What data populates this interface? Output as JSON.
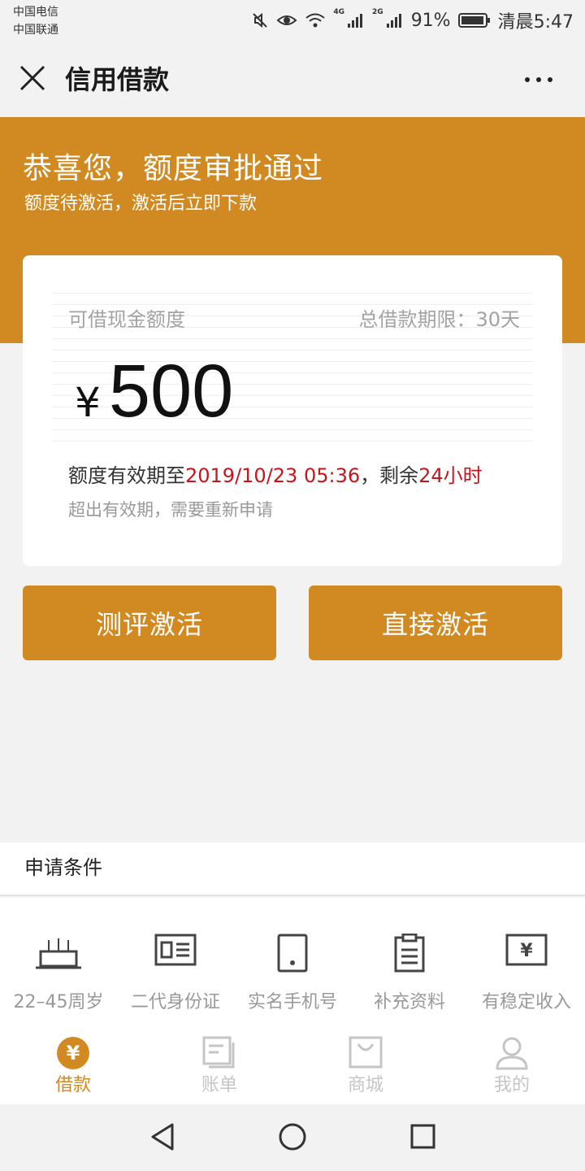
{
  "status_bar": {
    "carrier_1": "中国电信",
    "carrier_2": "中国联通",
    "net_1": "4G",
    "net_2": "2G",
    "battery": "91%",
    "time": "清晨5:47"
  },
  "header": {
    "title": "信用借款",
    "close_icon": "close-icon",
    "more_icon": "more-icon"
  },
  "banner": {
    "title": "恭喜您，额度审批通过",
    "subtitle": "额度待激活，激活后立即下款"
  },
  "card": {
    "label": "可借现金额度",
    "term": "总借款期限：30天",
    "currency": "¥",
    "amount": "500",
    "validity_prefix": "额度有效期至",
    "validity_date": "2019/10/23 05:36",
    "validity_mid": "，剩余",
    "validity_remaining": "24小时",
    "hint": "超出有效期，需要重新申请"
  },
  "buttons": {
    "evaluate": "测评激活",
    "direct": "直接激活"
  },
  "conditions": {
    "heading": "申请条件",
    "items": [
      {
        "icon": "cake-icon",
        "label": "22–45周岁"
      },
      {
        "icon": "id-card-icon",
        "label": "二代身份证"
      },
      {
        "icon": "phone-icon",
        "label": "实名手机号"
      },
      {
        "icon": "clipboard-icon",
        "label": "补充资料"
      },
      {
        "icon": "yen-bill-icon",
        "label": "有稳定收入"
      }
    ]
  },
  "tabs": [
    {
      "icon": "yen-circle-icon",
      "label": "借款",
      "active": true
    },
    {
      "icon": "bill-icon",
      "label": "账单",
      "active": false
    },
    {
      "icon": "bag-icon",
      "label": "商城",
      "active": false
    },
    {
      "icon": "user-icon",
      "label": "我的",
      "active": false
    }
  ],
  "colors": {
    "accent": "#d18a21",
    "warning_red": "#c8141c"
  }
}
